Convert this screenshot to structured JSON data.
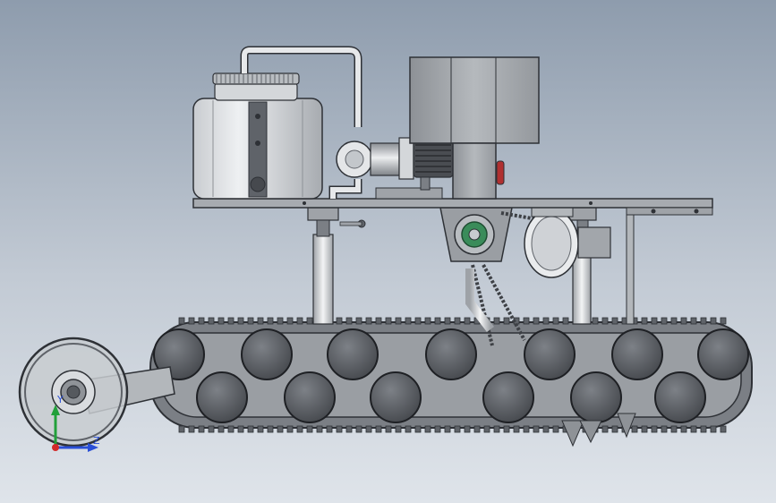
{
  "viewport": {
    "background_top": "#8e9cad",
    "background_bottom": "#dfe4ea"
  },
  "model": {
    "part_fill": "#a9adb2",
    "part_dark": "#5f6369",
    "part_stroke": "#2e3136",
    "accent_green": "#3a8c5a",
    "accent_red": "#b03030"
  },
  "triad": {
    "y_axis_label": "Y",
    "z_axis_label": "Z",
    "y_axis_color": "#21a03a",
    "z_axis_color": "#2a4fd6",
    "x_axis_color": "#d22a2a"
  }
}
